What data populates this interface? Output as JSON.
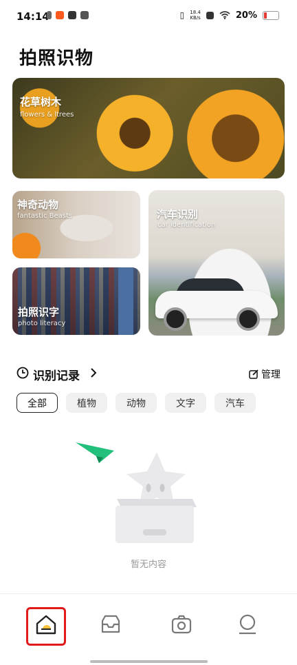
{
  "status_bar": {
    "time": "14:14",
    "net_speed_value": "18.4",
    "net_speed_unit": "KB/s",
    "battery": "20%"
  },
  "page": {
    "title": "拍照识物"
  },
  "cards": [
    {
      "title": "花草树木",
      "subtitle": "flowers & ltrees"
    },
    {
      "title": "神奇动物",
      "subtitle": "fantastic Beasts"
    },
    {
      "title": "拍照识字",
      "subtitle": "photo literacy"
    },
    {
      "title": "汽车识别",
      "subtitle": "car identification"
    }
  ],
  "records": {
    "title": "识别记录",
    "manage_label": "管理",
    "filters": [
      "全部",
      "植物",
      "动物",
      "文字",
      "汽车"
    ],
    "selected_filter": "全部",
    "empty_text": "暂无内容"
  },
  "bottom_nav": {
    "items": [
      {
        "icon": "home-icon",
        "selected": true
      },
      {
        "icon": "inbox-icon",
        "selected": false
      },
      {
        "icon": "camera-icon",
        "selected": false
      },
      {
        "icon": "profile-icon",
        "selected": false
      }
    ]
  },
  "colors": {
    "accent": "#F6C23E",
    "highlight_box": "#E01A1A",
    "paper_plane": "#22C07A"
  }
}
